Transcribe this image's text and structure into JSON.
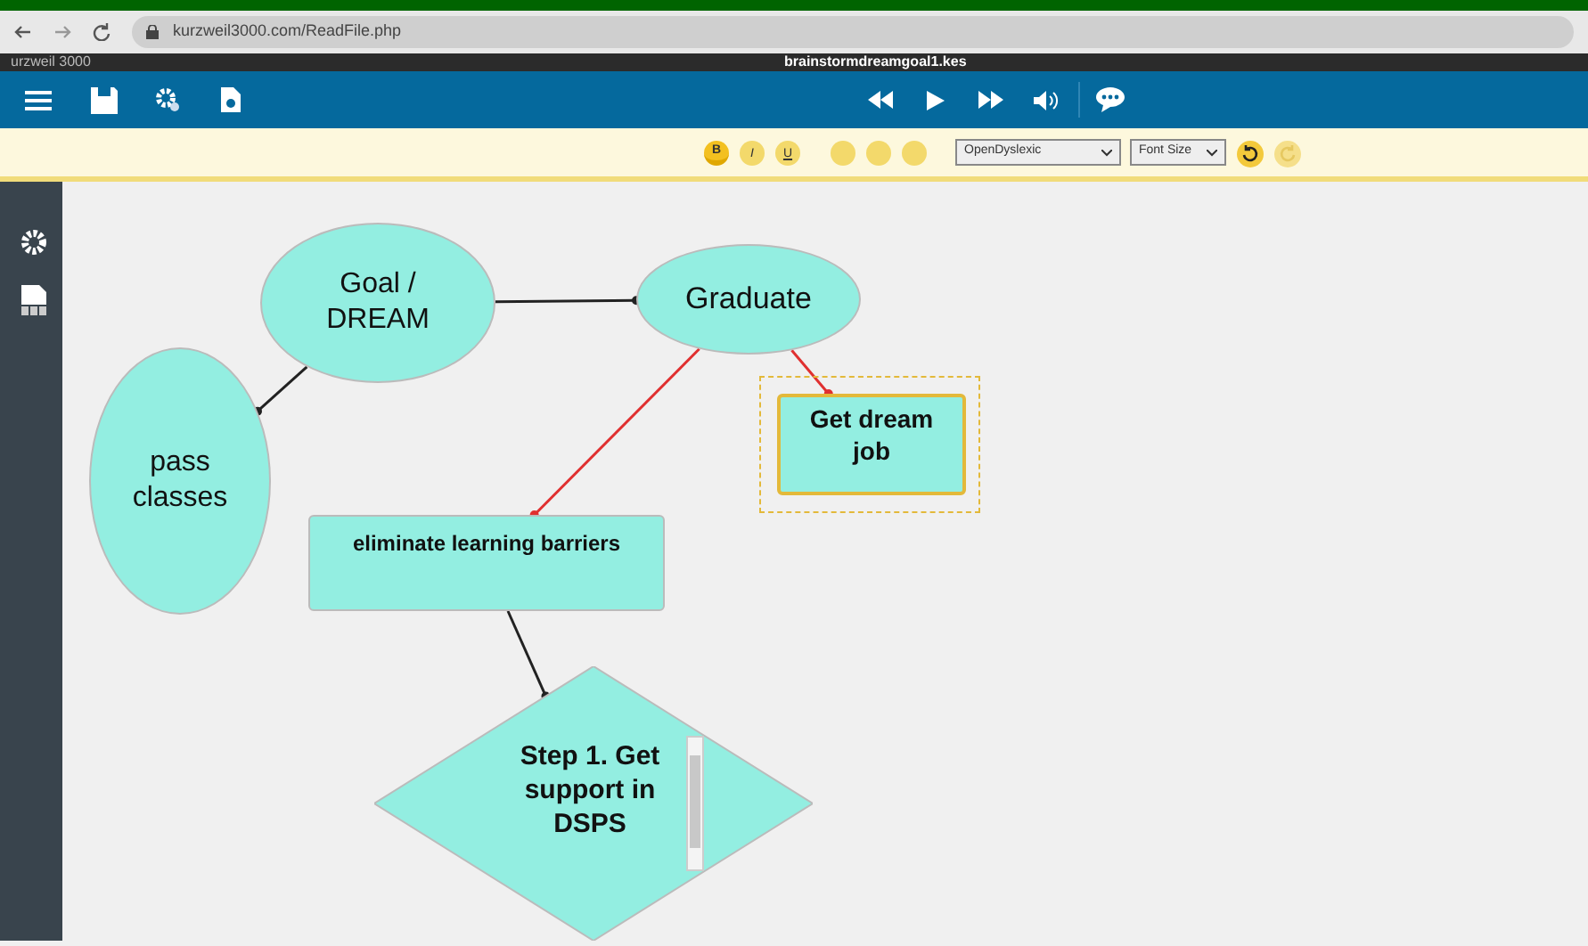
{
  "browser": {
    "url": "kurzweil3000.com/ReadFile.php"
  },
  "app": {
    "title": "urzweil 3000",
    "file_name": "brainstormdreamgoal1.kes"
  },
  "format_bar": {
    "styles": [
      {
        "label": "B",
        "selected": true
      },
      {
        "label": "I",
        "selected": false
      },
      {
        "label": "U",
        "selected": false
      }
    ],
    "font": "OpenDyslexic",
    "font_size": "Font Size"
  },
  "nodes": [
    {
      "kind": "ellipse",
      "text": "Goal / DREAM",
      "bold": false,
      "selected": false
    },
    {
      "kind": "ellipse",
      "text": "Graduate",
      "bold": false,
      "selected": false
    },
    {
      "kind": "ellipse",
      "text": "pass classes",
      "bold": false,
      "selected": false
    },
    {
      "kind": "rect",
      "text": "eliminate learning barriers",
      "bold": true,
      "selected": false
    },
    {
      "kind": "rect",
      "text": "Get dream job",
      "bold": true,
      "selected": true
    },
    {
      "kind": "diamond",
      "text": "Step 1. Get support in DSPS",
      "bold": true,
      "selected": false
    }
  ],
  "connectors": [
    {
      "color": "#222222"
    },
    {
      "color": "#222222"
    },
    {
      "color": "#e03030"
    },
    {
      "color": "#e03030"
    },
    {
      "color": "#222222"
    }
  ]
}
